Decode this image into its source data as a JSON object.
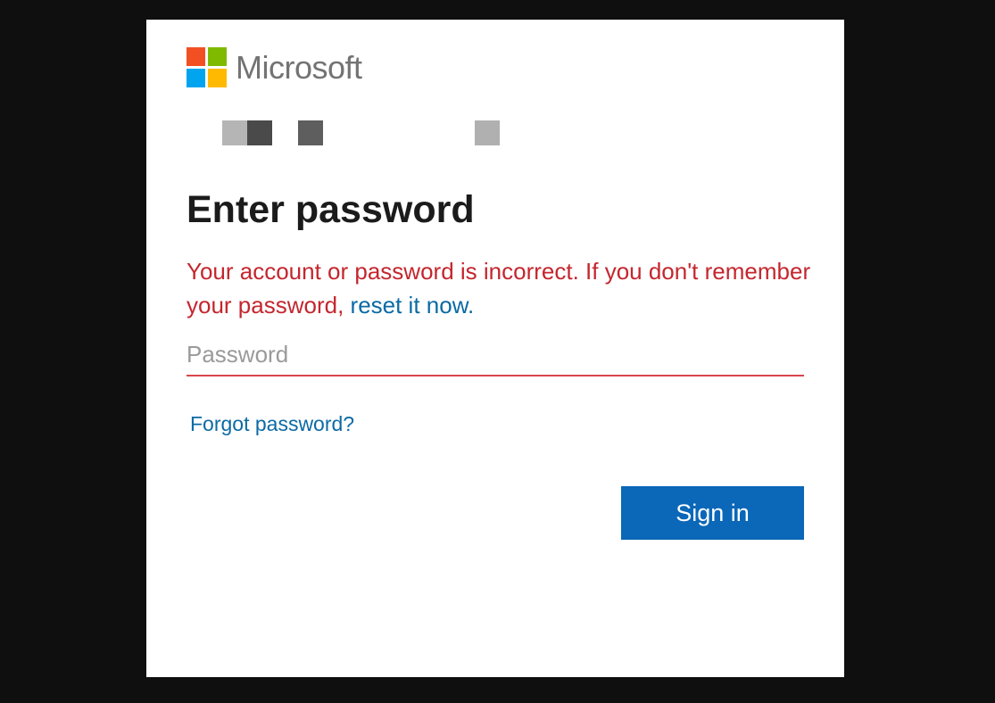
{
  "brand": {
    "name": "Microsoft",
    "logo_colors": [
      "#f25022",
      "#7fba00",
      "#00a4ef",
      "#ffb900"
    ]
  },
  "identity": {
    "redacted_blocks": [
      {
        "color": "#b5b5b5"
      },
      {
        "color": "#4a4a4a"
      },
      {
        "color": "#5e5e5e"
      },
      {
        "color": "#b0b0b0"
      }
    ]
  },
  "page": {
    "title": "Enter password"
  },
  "error": {
    "message": "Your account or password is incorrect. If you don't remember your password, ",
    "link_label": "reset it now."
  },
  "password": {
    "value": "",
    "placeholder": "Password"
  },
  "links": {
    "forgot_label": "Forgot password?"
  },
  "buttons": {
    "signin_label": "Sign in"
  },
  "colors": {
    "error": "#c4262e",
    "link": "#0b6aa4",
    "primary": "#0b67b7",
    "input_underline": "#d9464e"
  }
}
